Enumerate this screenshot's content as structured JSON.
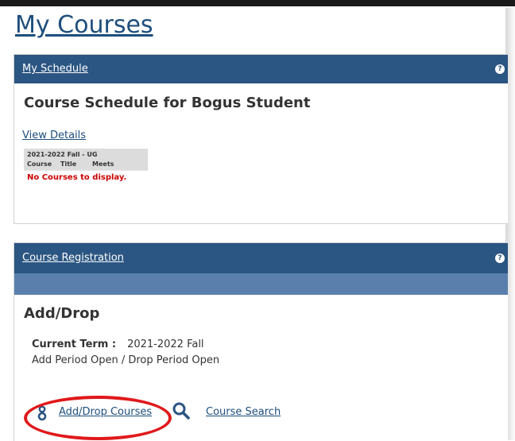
{
  "page": {
    "title": "My Courses"
  },
  "schedule_panel": {
    "header_link": "My Schedule",
    "help_glyph": "?",
    "heading": "Course Schedule for Bogus Student",
    "view_details": "View Details",
    "table": {
      "term": "2021-2022 Fall - UG",
      "columns": [
        "Course",
        "Title",
        "Meets"
      ],
      "empty_message": "No Courses to display."
    }
  },
  "registration_panel": {
    "header_link": "Course Registration",
    "help_glyph": "?",
    "heading": "Add/Drop",
    "current_term_label": "Current Term :",
    "current_term_value": "2021-2022 Fall",
    "period_status": "Add Period Open / Drop Period Open",
    "links": {
      "add_drop": "Add/Drop Courses",
      "add_drop_icon": "add-drop-icon",
      "course_search": "Course Search",
      "course_search_icon": "magnifier-icon"
    }
  },
  "colors": {
    "header_bg": "#2b5582",
    "subbar_bg": "#5b7fac",
    "link": "#1d4e7c",
    "error": "#cc0000",
    "highlight": "#e0191b"
  }
}
